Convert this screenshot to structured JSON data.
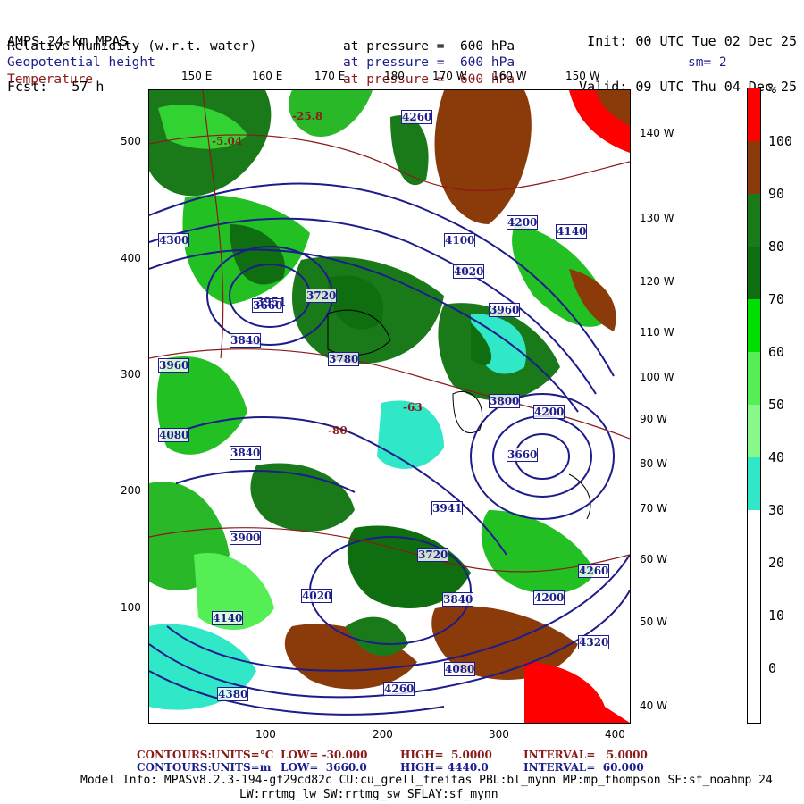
{
  "header": {
    "title_line1": "AMPS 24-km MPAS",
    "title_line2": "Fcst:   57 h",
    "init": "Init: 00 UTC Tue 02 Dec 25",
    "valid": "Valid: 09 UTC Thu 04 Dec 25",
    "field1_name": "Relative humidity (w.r.t. water)",
    "field1_pressure": "at pressure =  600 hPa",
    "field2_name": "Geopotential height",
    "field2_pressure": "at pressure =  600 hPa",
    "field3_name": "Temperature",
    "field3_pressure": "at pressure =  600 hPa",
    "smoothing": "sm= 2"
  },
  "axes": {
    "lon_top": [
      "150 E",
      "160 E",
      "170 E",
      "180",
      "170 W",
      "160 W",
      "150 W"
    ],
    "lon_right": [
      "140 W",
      "130 W",
      "120 W",
      "110 W",
      "100 W",
      "90 W",
      "80 W",
      "70 W",
      "60 W",
      "50 W",
      "40 W"
    ],
    "y_ticks": [
      "500",
      "400",
      "300",
      "200",
      "100"
    ],
    "x_ticks": [
      "100",
      "200",
      "300",
      "400"
    ]
  },
  "colorbar": {
    "unit": "%",
    "labels": [
      "100",
      "90",
      "80",
      "70",
      "60",
      "50",
      "40",
      "30",
      "20",
      "10",
      "0"
    ],
    "colors": [
      "#ff0000",
      "#8b3a0a",
      "#1a7a1a",
      "#0f6e0f",
      "#00e000",
      "#55ee55",
      "#88f888",
      "#30e8c8",
      "#ffffff",
      "#ffffff",
      "#ffffff",
      "#ffffff"
    ]
  },
  "map_labels": {
    "height": [
      "4260",
      "4300",
      "4200",
      "4100",
      "4140",
      "4020",
      "3960",
      "3840",
      "3780",
      "3660",
      "3720",
      "4080",
      "3960",
      "3840",
      "3900",
      "3780",
      "4200",
      "4320",
      "4260",
      "4380",
      "4260",
      "4200",
      "4320",
      "4260",
      "4140",
      "4020",
      "3960",
      "3900",
      "4260",
      "3720",
      "3960",
      "3840",
      "4080",
      "4020",
      "4260",
      "4320",
      "3941",
      "3840",
      "3780",
      "3660",
      "3951",
      "3800",
      "4200"
    ],
    "temperature": [
      "-25.8",
      "-5.04",
      "-63",
      "-80"
    ]
  },
  "footer": {
    "c1_label": "CONTOURS:",
    "c1_units": "UNITS=°C",
    "c1_low": "LOW= -30.000",
    "c1_high": "HIGH=  5.0000",
    "c1_interval": "INTERVAL=   5.0000",
    "c2_label": "CONTOURS:",
    "c2_units": "UNITS=m",
    "c2_low": "LOW=  3660.0",
    "c2_high": "HIGH= 4440.0",
    "c2_interval": "INTERVAL=  60.000",
    "model_info1": "Model Info: MPASv8.2.3-194-gf29cd82c CU:cu_grell_freitas PBL:bl_mynn MP:mp_thompson SF:sf_noahmp 24",
    "model_info2": "LW:rrtmg_lw SW:rrtmg_sw SFLAY:sf_mynn"
  }
}
